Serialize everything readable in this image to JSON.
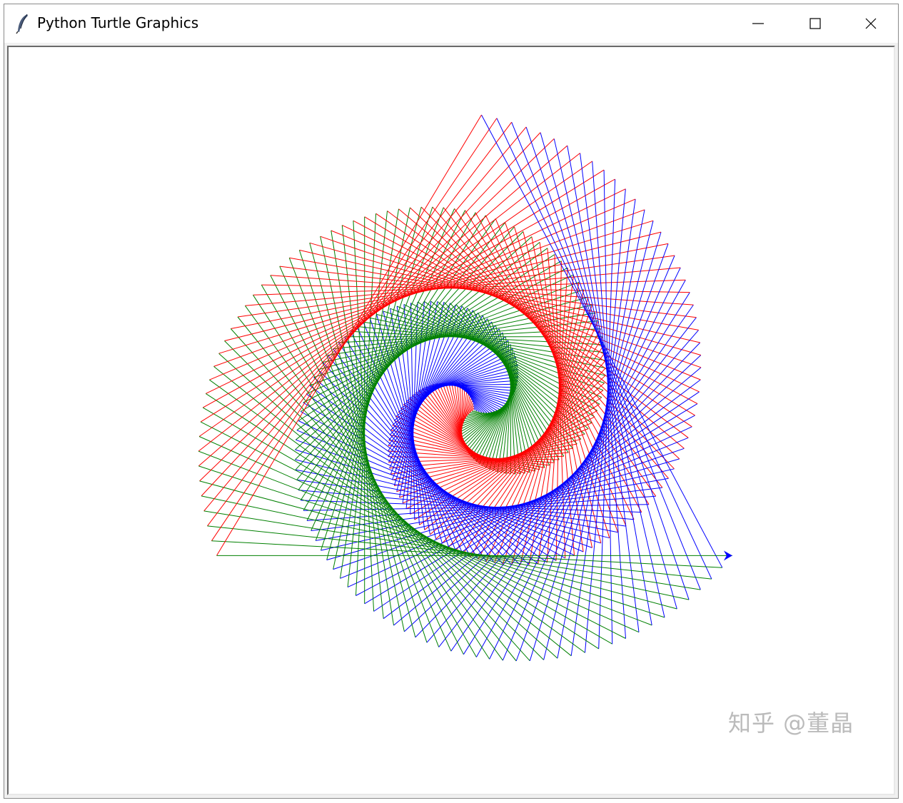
{
  "window": {
    "title": "Python Turtle Graphics",
    "icon": "feather-icon",
    "controls": {
      "minimize_icon": "minimize-icon",
      "maximize_icon": "maximize-icon",
      "close_icon": "close-icon"
    }
  },
  "canvas": {
    "background": "#ffffff",
    "pen_colors": [
      "#0000ff",
      "#ff0000",
      "#008000"
    ],
    "turtle_color": "#0000ff",
    "turtle_shape": "classic-arrow"
  },
  "watermark": {
    "text": "知乎 @董晶"
  }
}
